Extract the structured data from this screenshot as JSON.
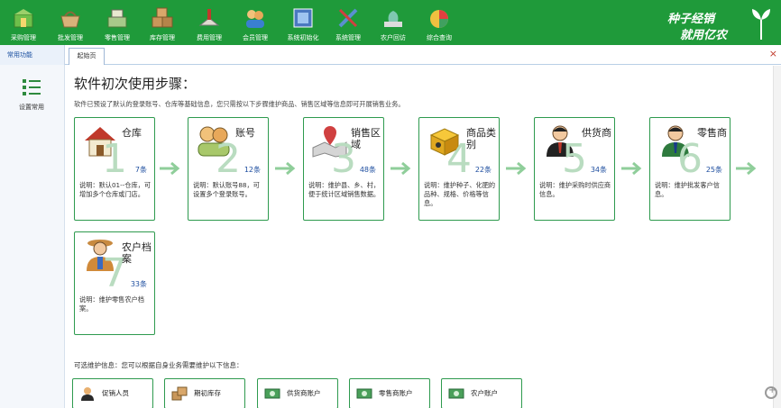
{
  "toolbar": {
    "items": [
      {
        "label": "采购管理",
        "icon": "purchase-icon",
        "color": "#8bc34a"
      },
      {
        "label": "批发管理",
        "icon": "wholesale-basket-icon",
        "color": "#c8a26a"
      },
      {
        "label": "零售管理",
        "icon": "cash-register-icon",
        "color": "#7fae6a"
      },
      {
        "label": "库存管理",
        "icon": "warehouse-boxes-icon",
        "color": "#c9975a"
      },
      {
        "label": "费用管理",
        "icon": "expense-icon",
        "color": "#c47a5a"
      },
      {
        "label": "会员管理",
        "icon": "members-icon",
        "color": "#e0b060"
      },
      {
        "label": "系统初始化",
        "icon": "system-init-icon",
        "color": "#5a7fc0"
      },
      {
        "label": "系统管理",
        "icon": "tools-icon",
        "color": "#5a8fd0"
      },
      {
        "label": "农户回访",
        "icon": "farmer-visit-icon",
        "color": "#7ec8b0"
      },
      {
        "label": "综合查询",
        "icon": "pie-chart-icon",
        "color": "#e04040"
      }
    ]
  },
  "brand": {
    "line1": "种子经销",
    "line2": "就用亿农"
  },
  "tabs": {
    "side_header": "常用功能",
    "active_tab": "起始页",
    "close": "×"
  },
  "sidebar": {
    "item_label": "设置常用"
  },
  "main": {
    "title": "软件初次使用步骤：",
    "description": "软件已预设了默认的登录账号、仓库等基础信息，您只需按以下步骤维护商品、销售区域等信息即可开展销售业务。",
    "steps": [
      {
        "num": "1",
        "name": "仓库",
        "count": "7条",
        "note": "说明：默认01--仓库，可增加多个仓库或门店。",
        "icon": "warehouse-house-icon"
      },
      {
        "num": "2",
        "name": "账号",
        "count": "12条",
        "note": "说明：默认账号88，可设置多个登录账号。",
        "icon": "users-account-icon"
      },
      {
        "num": "3",
        "name": "销售区域",
        "count": "48条",
        "note": "说明：维护县、乡、村，便于统计区域销售数据。",
        "icon": "map-pin-icon"
      },
      {
        "num": "4",
        "name": "商品类别",
        "count": "22条",
        "note": "说明：维护种子、化肥的品种、规格、价格等信息。",
        "icon": "product-box-icon"
      },
      {
        "num": "5",
        "name": "供货商",
        "count": "34条",
        "note": "说明：维护采购时供应商信息。",
        "icon": "supplier-person-icon"
      },
      {
        "num": "6",
        "name": "零售商",
        "count": "25条",
        "note": "说明：维护批发客户信息。",
        "icon": "retailer-person-icon"
      },
      {
        "num": "7",
        "name": "农户档案",
        "count": "33条",
        "note": "说明：维护零售农户档案。",
        "icon": "farmer-person-icon"
      }
    ],
    "optional_title": "可选维护信息：您可以根据自身业务需要维护以下信息：",
    "optional": [
      {
        "label": "促销人员",
        "icon": "promoter-icon"
      },
      {
        "label": "期初库存",
        "icon": "opening-stock-icon"
      },
      {
        "label": "供货商账户",
        "icon": "money-icon"
      },
      {
        "label": "零售商账户",
        "icon": "money-icon"
      },
      {
        "label": "农户账户",
        "icon": "money-icon"
      }
    ]
  },
  "colors": {
    "toolbar": "#1f9a3a",
    "card_border": "#2e9a4e",
    "arrow": "#8fce9a",
    "count": "#1f4fa0"
  }
}
